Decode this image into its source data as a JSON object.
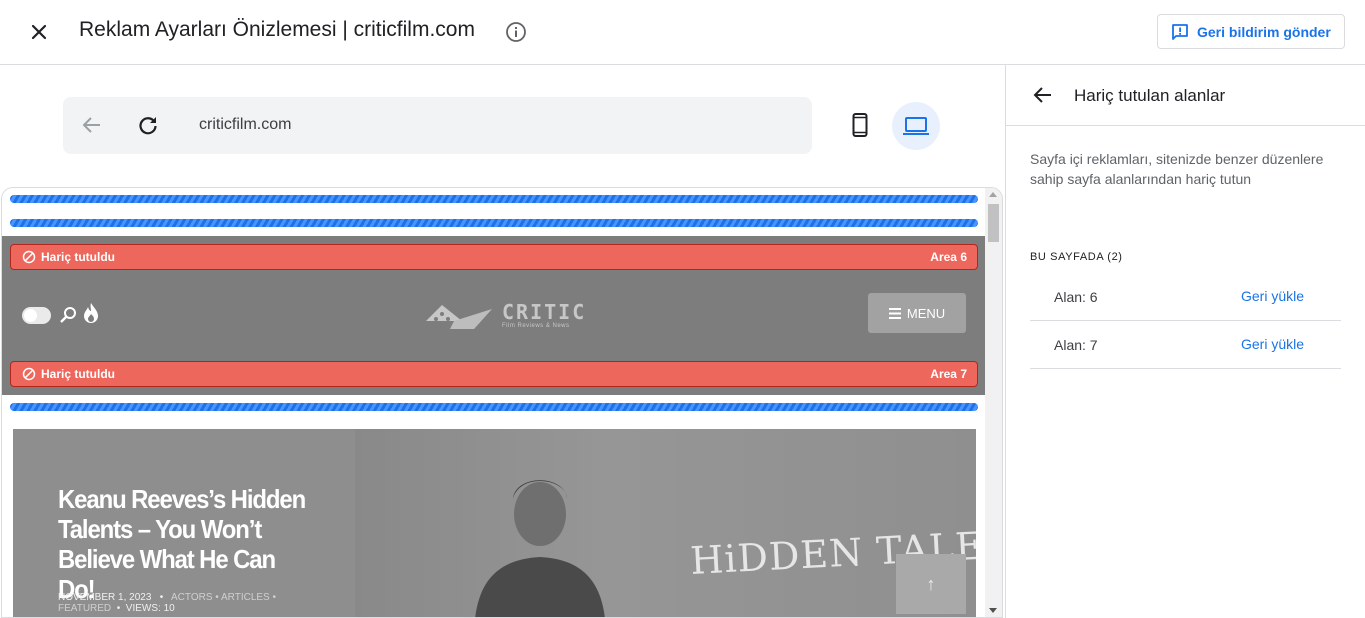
{
  "header": {
    "title": "Reklam Ayarları Önizlemesi | criticfilm.com",
    "feedback_label": "Geri bildirim gönder"
  },
  "browser": {
    "url": "criticfilm.com",
    "active_device": "desktop"
  },
  "site": {
    "excluded_areas": [
      {
        "label": "Hariç tutuldu",
        "area": "Area 6"
      },
      {
        "label": "Hariç tutuldu",
        "area": "Area 7"
      }
    ],
    "logo_text": "CRITIC",
    "logo_sub": "Film Reviews & News",
    "menu_label": "MENU",
    "hero": {
      "title": "Keanu Reeves’s Hidden Talents – You Won’t Believe What He Can Do!",
      "date": "NOVEMBER 1, 2023",
      "categories": "ACTORS • ARTICLES •",
      "featured": "FEATURED",
      "views": "VIEWS: 10",
      "image_text": "HiDDEN TALENTS",
      "to_top": "↑"
    }
  },
  "panel": {
    "title": "Hariç tutulan alanlar",
    "description": "Sayfa içi reklamları, sitenizde benzer düzenlere sahip sayfa alanlarından hariç tutun",
    "section_label": "BU SAYFADA (2)",
    "areas": [
      {
        "name": "Alan: 6",
        "action": "Geri yükle"
      },
      {
        "name": "Alan: 7",
        "action": "Geri yükle"
      }
    ]
  },
  "colors": {
    "accent": "#1a73e8",
    "excluded": "#ee675c"
  }
}
